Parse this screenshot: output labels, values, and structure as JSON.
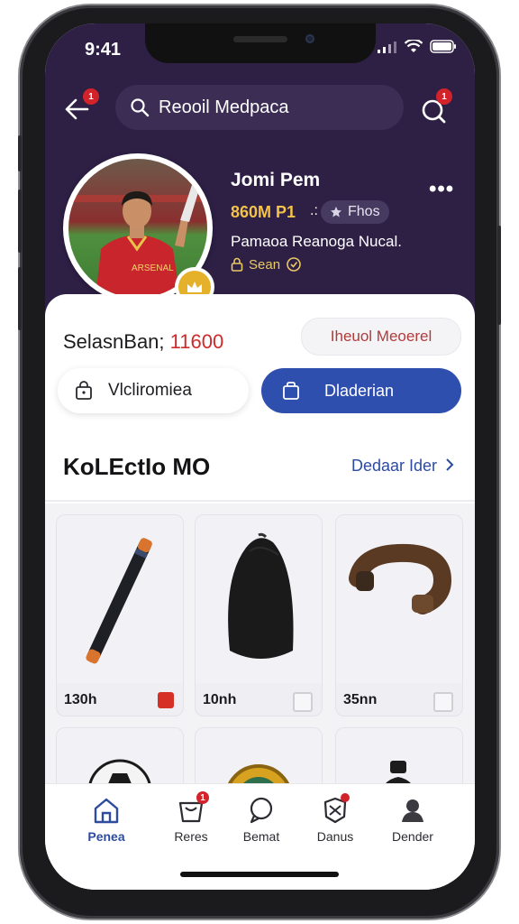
{
  "status": {
    "time": "9:41"
  },
  "search": {
    "text": "Reooil Medpaca",
    "back_badge": "1",
    "notif_badge": "1"
  },
  "profile": {
    "name": "Jomi Pem",
    "stat": "860M P1",
    "stat_sep": ".:",
    "tag": "Fhos",
    "description": "Pamaoa Reanoga Nucal.",
    "season": "Sean"
  },
  "balance": {
    "label": "SelasnBan;",
    "amount": "11600"
  },
  "actions": {
    "outline_pill": "Iheuol Meoerel",
    "secondary_button": "Vlcliromiea",
    "primary_button": "Dladerian"
  },
  "collection": {
    "title": "KoLEctIo MO",
    "see_all": "Dedaar Ider",
    "items": [
      {
        "price": "130h",
        "tag_color": "#d62f26"
      },
      {
        "price": "10nh",
        "tag_color": "#cfcfd4"
      },
      {
        "price": "35nn",
        "tag_color": "#cfcfd4"
      }
    ]
  },
  "tabs": [
    {
      "label": "Penea",
      "icon": "home-icon",
      "active": true
    },
    {
      "label": "Reres",
      "icon": "bag-icon",
      "badge": "1"
    },
    {
      "label": "Bemat",
      "icon": "chat-icon"
    },
    {
      "label": "Danus",
      "icon": "gift-icon",
      "badge": ""
    },
    {
      "label": "Dender",
      "icon": "user-icon"
    }
  ],
  "colors": {
    "header": "#2e1f45",
    "accent": "#2f4fae",
    "gold": "#e5b02a",
    "badge": "#d2232a"
  }
}
